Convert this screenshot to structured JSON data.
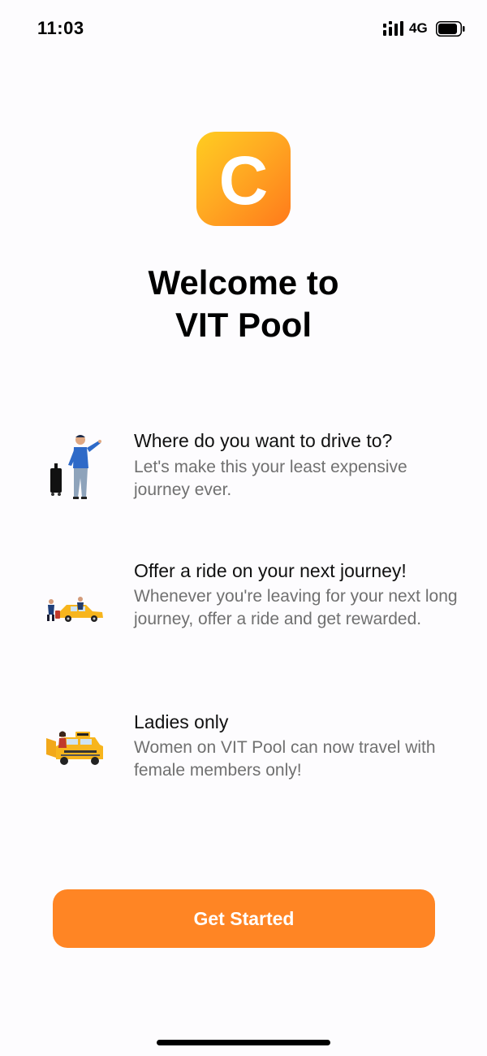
{
  "status_bar": {
    "time": "11:03",
    "network": "4G",
    "icons": [
      "signal-bars-icon",
      "battery-icon"
    ]
  },
  "app": {
    "logo_letter": "C",
    "logo_colors": [
      "#ffcd21",
      "#ff7a1b"
    ]
  },
  "welcome": {
    "line1": "Welcome to",
    "line2": "VIT Pool"
  },
  "features": [
    {
      "icon": "traveler-hailing-illustration",
      "title": "Where do you want to drive to?",
      "description": "Let's make this your least expensive journey ever."
    },
    {
      "icon": "taxi-passengers-illustration",
      "title": "Offer a ride on your next journey!",
      "description": "Whenever you're leaving for your next long journey, offer a ride and get rewarded."
    },
    {
      "icon": "taxi-woman-illustration",
      "title": "Ladies only",
      "description": "Women on VIT Pool can now travel with female members only!"
    }
  ],
  "cta": {
    "label": "Get Started",
    "color": "#ff8524"
  }
}
